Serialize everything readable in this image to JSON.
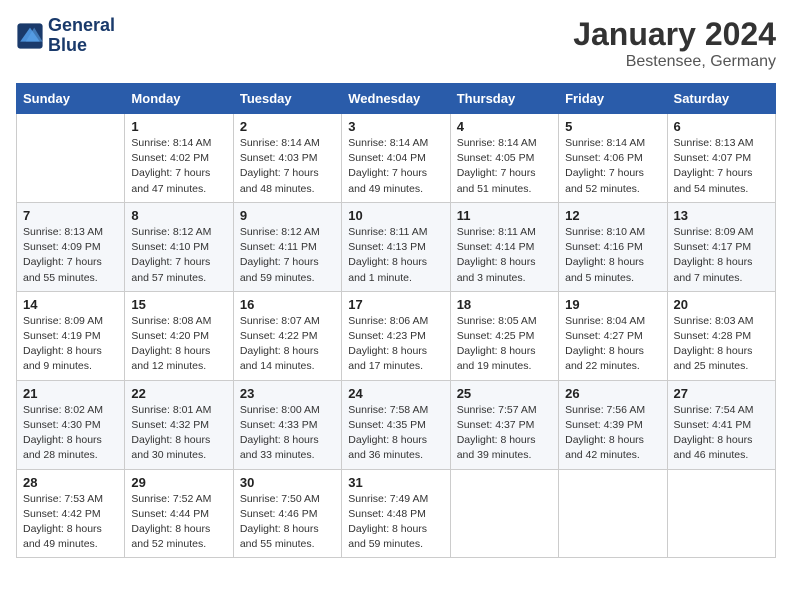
{
  "header": {
    "logo_line1": "General",
    "logo_line2": "Blue",
    "title": "January 2024",
    "subtitle": "Bestensee, Germany"
  },
  "days_of_week": [
    "Sunday",
    "Monday",
    "Tuesday",
    "Wednesday",
    "Thursday",
    "Friday",
    "Saturday"
  ],
  "weeks": [
    [
      {
        "day": "",
        "info": ""
      },
      {
        "day": "1",
        "info": "Sunrise: 8:14 AM\nSunset: 4:02 PM\nDaylight: 7 hours\nand 47 minutes."
      },
      {
        "day": "2",
        "info": "Sunrise: 8:14 AM\nSunset: 4:03 PM\nDaylight: 7 hours\nand 48 minutes."
      },
      {
        "day": "3",
        "info": "Sunrise: 8:14 AM\nSunset: 4:04 PM\nDaylight: 7 hours\nand 49 minutes."
      },
      {
        "day": "4",
        "info": "Sunrise: 8:14 AM\nSunset: 4:05 PM\nDaylight: 7 hours\nand 51 minutes."
      },
      {
        "day": "5",
        "info": "Sunrise: 8:14 AM\nSunset: 4:06 PM\nDaylight: 7 hours\nand 52 minutes."
      },
      {
        "day": "6",
        "info": "Sunrise: 8:13 AM\nSunset: 4:07 PM\nDaylight: 7 hours\nand 54 minutes."
      }
    ],
    [
      {
        "day": "7",
        "info": "Sunrise: 8:13 AM\nSunset: 4:09 PM\nDaylight: 7 hours\nand 55 minutes."
      },
      {
        "day": "8",
        "info": "Sunrise: 8:12 AM\nSunset: 4:10 PM\nDaylight: 7 hours\nand 57 minutes."
      },
      {
        "day": "9",
        "info": "Sunrise: 8:12 AM\nSunset: 4:11 PM\nDaylight: 7 hours\nand 59 minutes."
      },
      {
        "day": "10",
        "info": "Sunrise: 8:11 AM\nSunset: 4:13 PM\nDaylight: 8 hours\nand 1 minute."
      },
      {
        "day": "11",
        "info": "Sunrise: 8:11 AM\nSunset: 4:14 PM\nDaylight: 8 hours\nand 3 minutes."
      },
      {
        "day": "12",
        "info": "Sunrise: 8:10 AM\nSunset: 4:16 PM\nDaylight: 8 hours\nand 5 minutes."
      },
      {
        "day": "13",
        "info": "Sunrise: 8:09 AM\nSunset: 4:17 PM\nDaylight: 8 hours\nand 7 minutes."
      }
    ],
    [
      {
        "day": "14",
        "info": "Sunrise: 8:09 AM\nSunset: 4:19 PM\nDaylight: 8 hours\nand 9 minutes."
      },
      {
        "day": "15",
        "info": "Sunrise: 8:08 AM\nSunset: 4:20 PM\nDaylight: 8 hours\nand 12 minutes."
      },
      {
        "day": "16",
        "info": "Sunrise: 8:07 AM\nSunset: 4:22 PM\nDaylight: 8 hours\nand 14 minutes."
      },
      {
        "day": "17",
        "info": "Sunrise: 8:06 AM\nSunset: 4:23 PM\nDaylight: 8 hours\nand 17 minutes."
      },
      {
        "day": "18",
        "info": "Sunrise: 8:05 AM\nSunset: 4:25 PM\nDaylight: 8 hours\nand 19 minutes."
      },
      {
        "day": "19",
        "info": "Sunrise: 8:04 AM\nSunset: 4:27 PM\nDaylight: 8 hours\nand 22 minutes."
      },
      {
        "day": "20",
        "info": "Sunrise: 8:03 AM\nSunset: 4:28 PM\nDaylight: 8 hours\nand 25 minutes."
      }
    ],
    [
      {
        "day": "21",
        "info": "Sunrise: 8:02 AM\nSunset: 4:30 PM\nDaylight: 8 hours\nand 28 minutes."
      },
      {
        "day": "22",
        "info": "Sunrise: 8:01 AM\nSunset: 4:32 PM\nDaylight: 8 hours\nand 30 minutes."
      },
      {
        "day": "23",
        "info": "Sunrise: 8:00 AM\nSunset: 4:33 PM\nDaylight: 8 hours\nand 33 minutes."
      },
      {
        "day": "24",
        "info": "Sunrise: 7:58 AM\nSunset: 4:35 PM\nDaylight: 8 hours\nand 36 minutes."
      },
      {
        "day": "25",
        "info": "Sunrise: 7:57 AM\nSunset: 4:37 PM\nDaylight: 8 hours\nand 39 minutes."
      },
      {
        "day": "26",
        "info": "Sunrise: 7:56 AM\nSunset: 4:39 PM\nDaylight: 8 hours\nand 42 minutes."
      },
      {
        "day": "27",
        "info": "Sunrise: 7:54 AM\nSunset: 4:41 PM\nDaylight: 8 hours\nand 46 minutes."
      }
    ],
    [
      {
        "day": "28",
        "info": "Sunrise: 7:53 AM\nSunset: 4:42 PM\nDaylight: 8 hours\nand 49 minutes."
      },
      {
        "day": "29",
        "info": "Sunrise: 7:52 AM\nSunset: 4:44 PM\nDaylight: 8 hours\nand 52 minutes."
      },
      {
        "day": "30",
        "info": "Sunrise: 7:50 AM\nSunset: 4:46 PM\nDaylight: 8 hours\nand 55 minutes."
      },
      {
        "day": "31",
        "info": "Sunrise: 7:49 AM\nSunset: 4:48 PM\nDaylight: 8 hours\nand 59 minutes."
      },
      {
        "day": "",
        "info": ""
      },
      {
        "day": "",
        "info": ""
      },
      {
        "day": "",
        "info": ""
      }
    ]
  ]
}
